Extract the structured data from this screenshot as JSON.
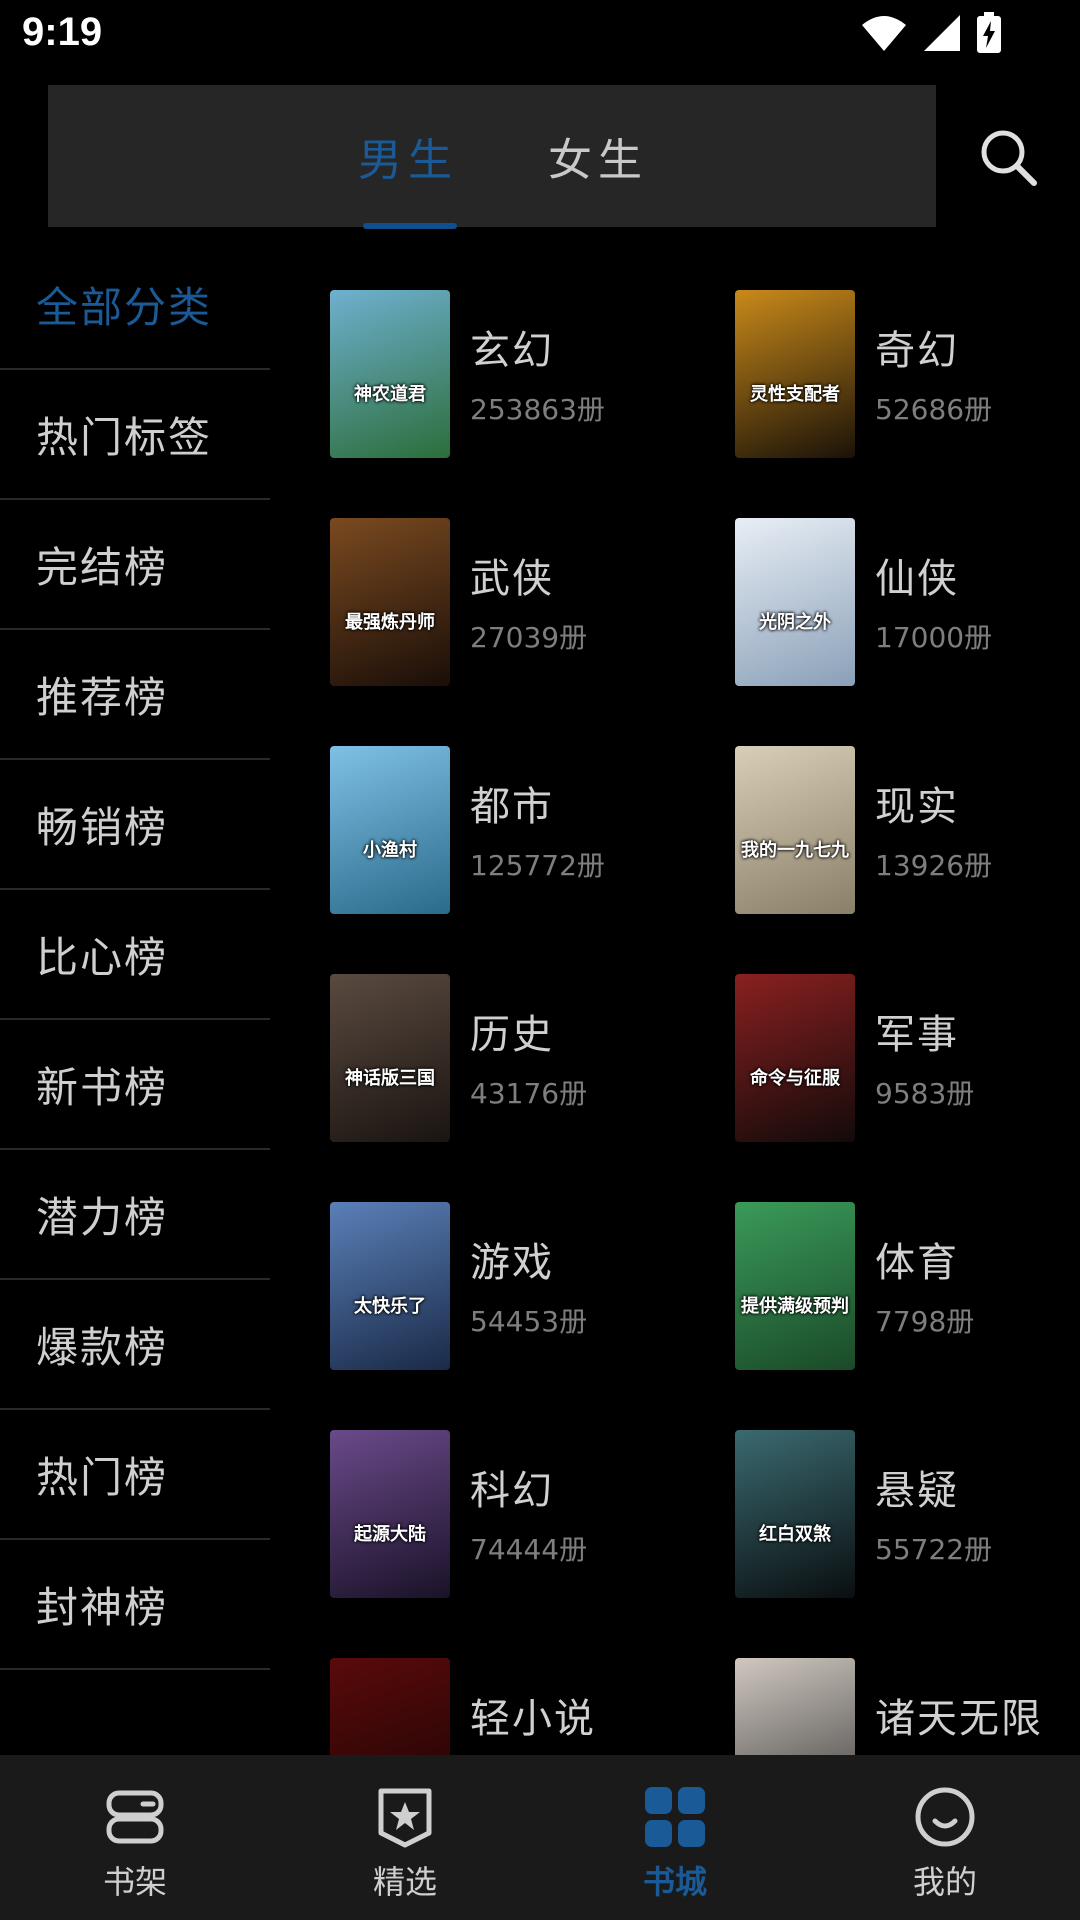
{
  "status": {
    "time": "9:19"
  },
  "header": {
    "tabs": [
      {
        "label": "男生",
        "active": true
      },
      {
        "label": "女生",
        "active": false
      }
    ],
    "search_icon": "search-icon",
    "accent_color": "#1a5a96"
  },
  "sidebar": {
    "items": [
      {
        "label": "全部分类",
        "active": true
      },
      {
        "label": "热门标签"
      },
      {
        "label": "完结榜"
      },
      {
        "label": "推荐榜"
      },
      {
        "label": "畅销榜"
      },
      {
        "label": "比心榜"
      },
      {
        "label": "新书榜"
      },
      {
        "label": "潜力榜"
      },
      {
        "label": "爆款榜"
      },
      {
        "label": "热门榜"
      },
      {
        "label": "封神榜"
      }
    ]
  },
  "categories": [
    {
      "name": "玄幻",
      "count": "253863册",
      "cover_title": "神农道君",
      "cover_colors": [
        "#6fb0d0",
        "#2b6e3a"
      ]
    },
    {
      "name": "奇幻",
      "count": "52686册",
      "cover_title": "灵性支配者",
      "cover_colors": [
        "#c98a1a",
        "#1a1208"
      ]
    },
    {
      "name": "武侠",
      "count": "27039册",
      "cover_title": "最强炼丹师",
      "cover_colors": [
        "#7a4a20",
        "#1a0e08"
      ]
    },
    {
      "name": "仙侠",
      "count": "17000册",
      "cover_title": "光阴之外",
      "cover_colors": [
        "#e8eef5",
        "#8aa0b8"
      ]
    },
    {
      "name": "都市",
      "count": "125772册",
      "cover_title": "小渔村",
      "cover_colors": [
        "#7fc0e6",
        "#2a6a8a"
      ]
    },
    {
      "name": "现实",
      "count": "13926册",
      "cover_title": "我的一九七九",
      "cover_colors": [
        "#d8cfb8",
        "#8a7f68"
      ]
    },
    {
      "name": "历史",
      "count": "43176册",
      "cover_title": "神话版三国",
      "cover_colors": [
        "#5a4a40",
        "#1a1410"
      ]
    },
    {
      "name": "军事",
      "count": "9583册",
      "cover_title": "命令与征服",
      "cover_colors": [
        "#8a2020",
        "#120a0a"
      ]
    },
    {
      "name": "游戏",
      "count": "54453册",
      "cover_title": "太快乐了",
      "cover_colors": [
        "#5a80b8",
        "#1a2a48"
      ]
    },
    {
      "name": "体育",
      "count": "7798册",
      "cover_title": "提供满级预判",
      "cover_colors": [
        "#3a9a5a",
        "#1a4a28"
      ]
    },
    {
      "name": "科幻",
      "count": "74444册",
      "cover_title": "起源大陆",
      "cover_colors": [
        "#6a4a8a",
        "#1a1228"
      ]
    },
    {
      "name": "悬疑",
      "count": "55722册",
      "cover_title": "红白双煞",
      "cover_colors": [
        "#3a6a70",
        "#0a0e10"
      ]
    },
    {
      "name": "轻小说",
      "count": "",
      "cover_title": "",
      "cover_colors": [
        "#5a0a0a",
        "#1a0404"
      ]
    },
    {
      "name": "诸天无限",
      "count": "",
      "cover_title": "",
      "cover_colors": [
        "#d0c8c0",
        "#3a3a3a"
      ]
    }
  ],
  "bottom_nav": {
    "items": [
      {
        "label": "书架",
        "icon": "bookshelf-icon",
        "active": false
      },
      {
        "label": "精选",
        "icon": "star-badge-icon",
        "active": false
      },
      {
        "label": "书城",
        "icon": "grid-icon",
        "active": true
      },
      {
        "label": "我的",
        "icon": "smile-icon",
        "active": false
      }
    ]
  }
}
